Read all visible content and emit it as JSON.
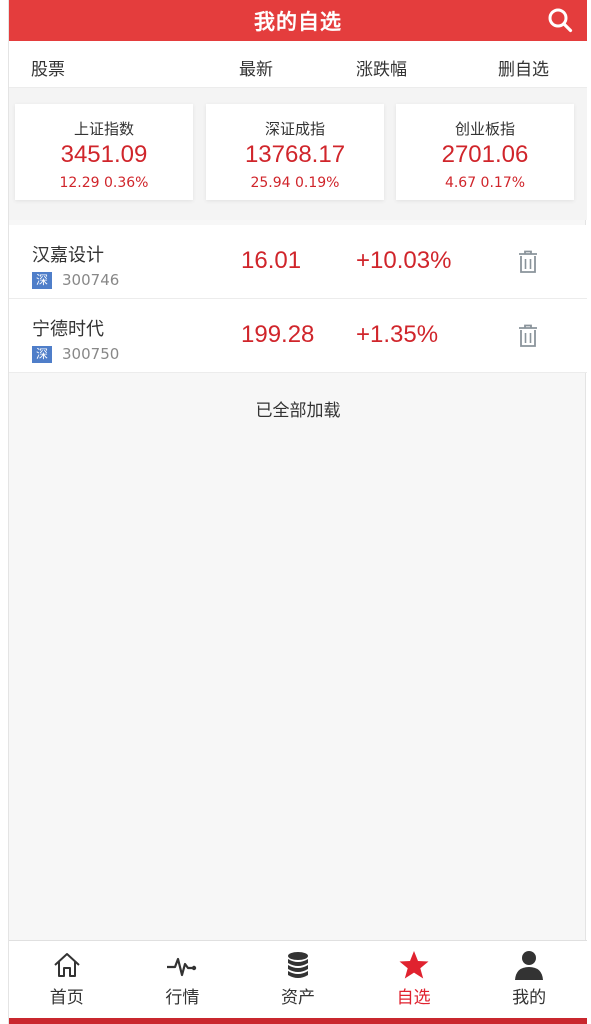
{
  "header": {
    "title": "我的自选",
    "search_icon": "search-icon"
  },
  "columns": {
    "stock": "股票",
    "latest": "最新",
    "change": "涨跌幅",
    "remove": "删自选"
  },
  "indices": [
    {
      "name": "上证指数",
      "value": "3451.09",
      "change": "12.29 0.36%"
    },
    {
      "name": "深证成指",
      "value": "13768.17",
      "change": "25.94 0.19%"
    },
    {
      "name": "创业板指",
      "value": "2701.06",
      "change": "4.67 0.17%"
    }
  ],
  "stocks": [
    {
      "name": "汉嘉设计",
      "market": "深",
      "code": "300746",
      "price": "16.01",
      "change_pct": "+10.03%"
    },
    {
      "name": "宁德时代",
      "market": "深",
      "code": "300750",
      "price": "199.28",
      "change_pct": "+1.35%"
    }
  ],
  "list_footer": "已全部加载",
  "tabs": [
    {
      "label": "首页",
      "icon": "home-icon"
    },
    {
      "label": "行情",
      "icon": "pulse-icon"
    },
    {
      "label": "资产",
      "icon": "coins-icon"
    },
    {
      "label": "自选",
      "icon": "star-icon",
      "active": true
    },
    {
      "label": "我的",
      "icon": "user-icon"
    }
  ],
  "colors": {
    "brand": "#e43d3d",
    "up": "#d0252b",
    "market_badge": "#4f7ec9"
  }
}
